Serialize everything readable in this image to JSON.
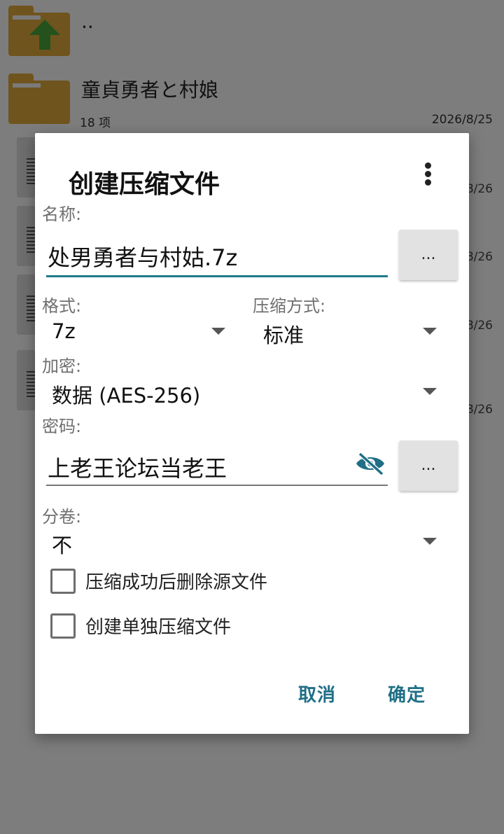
{
  "background": {
    "parent_label": "..",
    "folder": {
      "name": "童貞勇者と村娘",
      "count": "18 项",
      "date": "2026/8/25"
    },
    "file_dates": [
      "8/26",
      "8/26",
      "8/26",
      "8/26"
    ]
  },
  "dialog": {
    "title": "创建压缩文件",
    "menu_icon": "more-vert-icon",
    "name_label": "名称:",
    "name_value": "处男勇者与村姑.7z",
    "browse_label": "...",
    "format_label": "格式:",
    "format_value": "7z",
    "method_label": "压缩方式:",
    "method_value": "标准",
    "encryption_label": "加密:",
    "encryption_value": "数据 (AES-256)",
    "password_label": "密码:",
    "password_value": "上老王论坛当老王",
    "password_toggle_icon": "visibility-off-icon",
    "password_browse_label": "...",
    "split_label": "分卷:",
    "split_value": "不",
    "options": [
      {
        "label": "压缩成功后删除源文件",
        "checked": false
      },
      {
        "label": "创建单独压缩文件",
        "checked": false
      }
    ],
    "cancel_label": "取消",
    "ok_label": "确定"
  },
  "colors": {
    "accent": "#1f6f86",
    "field_underline_active": "#1f7a8c",
    "folder": "#e1a83a",
    "up_arrow": "#4aa33a"
  }
}
